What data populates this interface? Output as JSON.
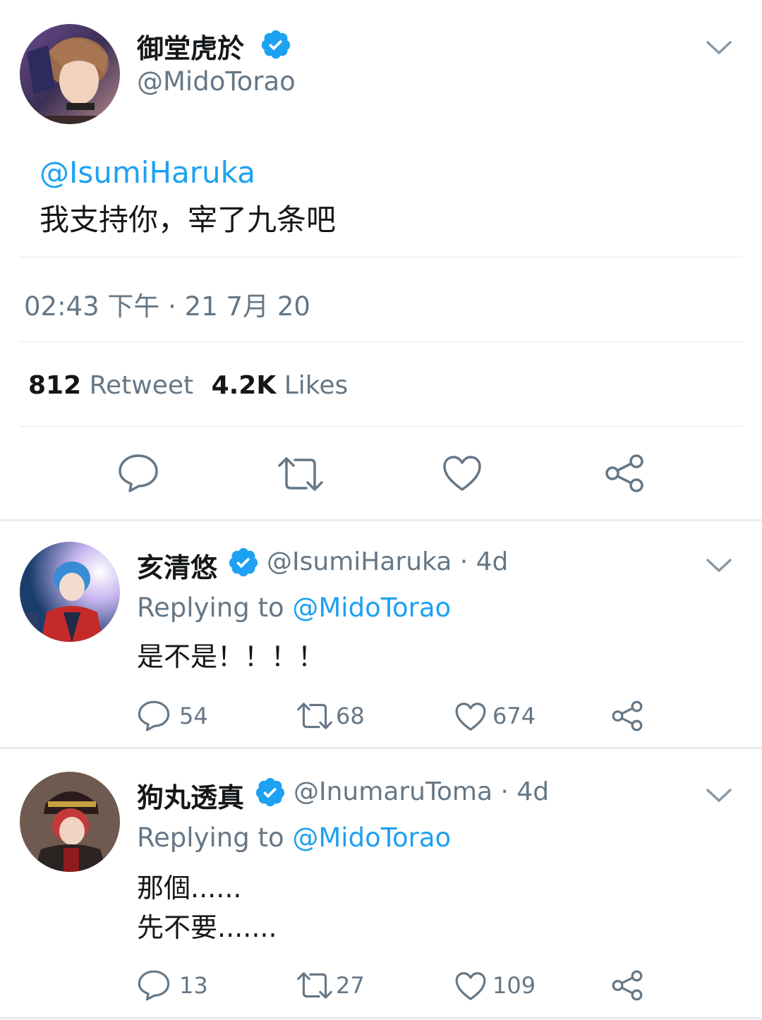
{
  "main_tweet": {
    "display_name": "御堂虎於",
    "handle": "@MidoTorao",
    "mention": "@IsumiHaruka",
    "text": "我支持你，宰了九条吧",
    "timestamp": "02:43 下午 · 21 7月 20",
    "retweet_count": "812",
    "retweet_label": "Retweet",
    "like_count": "4.2K",
    "like_label": "Likes"
  },
  "replies": [
    {
      "display_name": "亥清悠",
      "handle": "@IsumiHaruka",
      "age": "· 4d",
      "replying_prefix": "Replying to",
      "replying_to": "@MidoTorao",
      "text_lines": [
        "是不是！！！！"
      ],
      "reply_count": "54",
      "retweet_count": "68",
      "like_count": "674"
    },
    {
      "display_name": "狗丸透真",
      "handle": "@InumaruToma",
      "age": "· 4d",
      "replying_prefix": "Replying to",
      "replying_to": "@MidoTorao",
      "text_lines": [
        "那個......",
        "先不要......."
      ],
      "reply_count": "13",
      "retweet_count": "27",
      "like_count": "109"
    }
  ],
  "colors": {
    "accent": "#1da1f2",
    "secondary_text": "#657786",
    "primary_text": "#14171a"
  },
  "icons": [
    "verified-badge-icon",
    "chevron-down-icon",
    "reply-icon",
    "retweet-icon",
    "like-icon",
    "share-icon"
  ]
}
